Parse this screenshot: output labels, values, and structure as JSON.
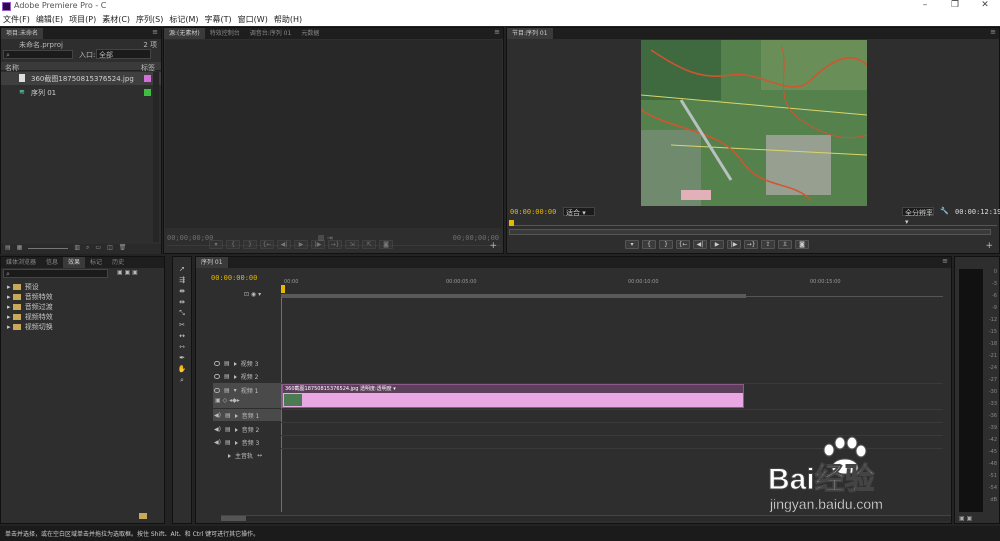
{
  "app": {
    "title": "Adobe Premiere Pro - C"
  },
  "menu": [
    "文件(F)",
    "编辑(E)",
    "项目(P)",
    "素材(C)",
    "序列(S)",
    "标记(M)",
    "字幕(T)",
    "窗口(W)",
    "帮助(H)"
  ],
  "project": {
    "tab": "项目:未命名",
    "filename": "未命名.prproj",
    "count": "2 项",
    "search_placeholder": "",
    "entry_label": "入口:",
    "entry_value": "全部",
    "col_name": "名称",
    "col_label": "标签",
    "items": [
      {
        "name": "360截图18750815376524.jpg",
        "color": "#d36fd9"
      },
      {
        "name": "序列 01",
        "color": "#3fbf3f"
      }
    ]
  },
  "source": {
    "tabs": [
      "源:(无素材)",
      "特效控制台",
      "调音台:序列 01",
      "元数据"
    ],
    "tc_left": "00;00;00;00",
    "tc_right": "00;00;00;00"
  },
  "program": {
    "tab": "节目:序列 01",
    "tc_current": "00:00:00:00",
    "fit": "适合",
    "quality": "全分辨率",
    "tc_duration": "00:00:12:19"
  },
  "effects": {
    "tabs": [
      "媒体浏览器",
      "信息",
      "效果",
      "标记",
      "历史"
    ],
    "items": [
      "预设",
      "音频特效",
      "音频过渡",
      "视频特效",
      "视频切换"
    ]
  },
  "timeline": {
    "tab": "序列 01",
    "tc": "00:00:00:00",
    "ruler": [
      "00:00",
      "00:00:05:00",
      "00:00:10:00",
      "00:00:15:00"
    ],
    "tracks": [
      {
        "name": "视频 3",
        "kind": "video"
      },
      {
        "name": "视频 2",
        "kind": "video"
      },
      {
        "name": "视频 1",
        "kind": "video"
      },
      {
        "name": "音频 1",
        "kind": "audio"
      },
      {
        "name": "音频 2",
        "kind": "audio"
      },
      {
        "name": "音频 3",
        "kind": "audio"
      },
      {
        "name": "主音轨",
        "kind": "master"
      }
    ],
    "clip": {
      "label": "360截图18750815376524.jpg",
      "effect": "透明度:透明度"
    }
  },
  "meter": {
    "labels": [
      "0",
      "-3",
      "-6",
      "-9",
      "-12",
      "-15",
      "-18",
      "-21",
      "-24",
      "-27",
      "-30",
      "-33",
      "-36",
      "-39",
      "-42",
      "-45",
      "-48",
      "-51",
      "-54",
      "dB"
    ]
  },
  "status": {
    "text": "单击并选择，或在空白区域单击并拖拉为选取框。按住 Shift、Alt、和 Ctrl 键可进行其它操作。"
  },
  "watermark": {
    "brand": "Bai经验",
    "url": "jingyan.baidu.com"
  },
  "colors": {
    "timecode": "#e6b800",
    "clip": "#e9a7e4",
    "playhead": "#d64a2a"
  }
}
